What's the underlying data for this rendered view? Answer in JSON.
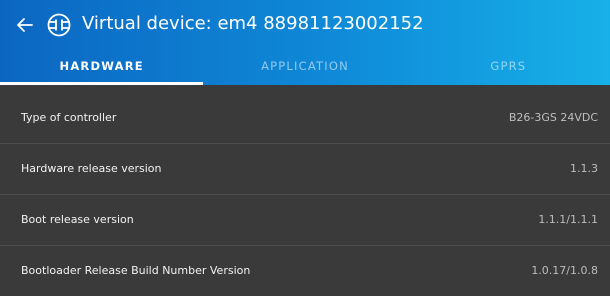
{
  "header": {
    "title": "Virtual device: em4 88981123002152",
    "back_icon": "arrow-left-icon",
    "device_icon": "connected-device-icon"
  },
  "colors": {
    "header_start": "#0b66c2",
    "header_end": "#17b0e8",
    "background": "#3a3a3a",
    "divider": "#4d4d4d"
  },
  "tabs": [
    {
      "label": "HARDWARE",
      "active": true
    },
    {
      "label": "APPLICATION",
      "active": false
    },
    {
      "label": "GPRS",
      "active": false
    }
  ],
  "rows": [
    {
      "label": "Type of controller",
      "value": "B26-3GS 24VDC"
    },
    {
      "label": "Hardware release version",
      "value": "1.1.3"
    },
    {
      "label": "Boot release version",
      "value": "1.1.1/1.1.1"
    },
    {
      "label": "Bootloader Release Build Number Version",
      "value": "1.0.17/1.0.8"
    }
  ]
}
